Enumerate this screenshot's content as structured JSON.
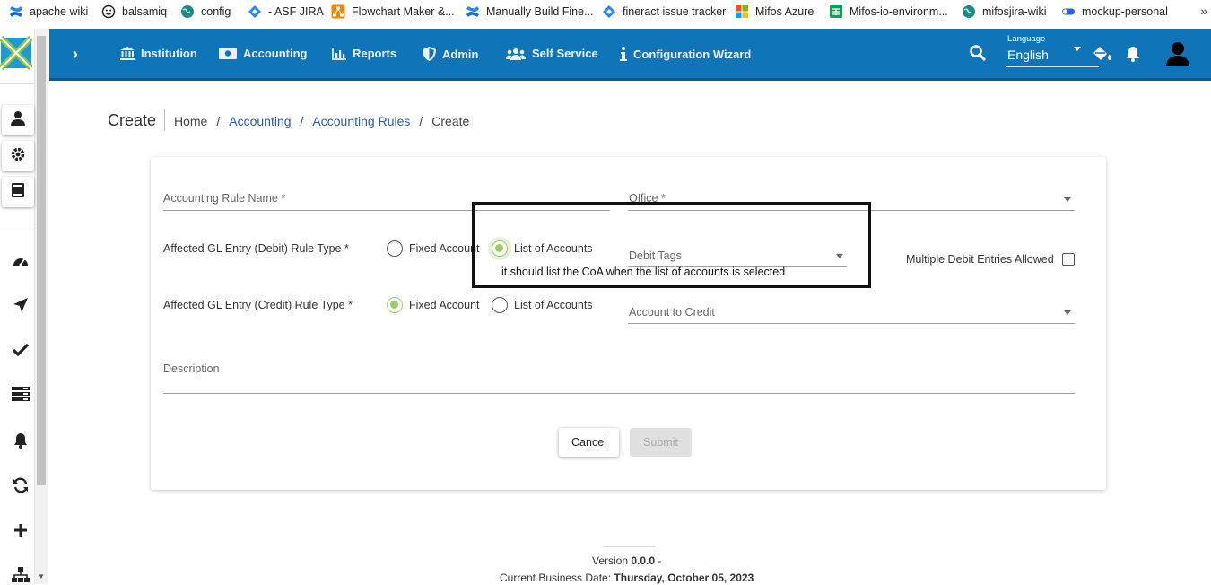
{
  "bookmarks": [
    {
      "label": "apache wiki",
      "icon": "confluence-icon"
    },
    {
      "label": "balsamiq",
      "icon": "smiley-icon"
    },
    {
      "label": "config",
      "icon": "globe-icon"
    },
    {
      "label": "- ASF JIRA",
      "icon": "jira-icon"
    },
    {
      "label": "Flowchart Maker &...",
      "icon": "drawio-icon"
    },
    {
      "label": "Manually Build Fine...",
      "icon": "confluence-icon"
    },
    {
      "label": "fineract issue tracker",
      "icon": "jira-icon"
    },
    {
      "label": "Mifos Azure",
      "icon": "microsoft-icon"
    },
    {
      "label": "Mifos-io-environm...",
      "icon": "sheets-icon"
    },
    {
      "label": "mifosjira-wiki",
      "icon": "globe-icon"
    },
    {
      "label": "mockup-personal",
      "icon": "toggle-icon"
    }
  ],
  "bookmarks_more": "»",
  "nav": {
    "toggle": "›",
    "items": [
      "Institution",
      "Accounting",
      "Reports",
      "Admin",
      "Self Service",
      "Configuration Wizard"
    ],
    "language_label": "Language",
    "language_value": "English"
  },
  "header": {
    "title": "Create",
    "breadcrumbs": [
      "Home",
      "Accounting",
      "Accounting Rules",
      "Create"
    ],
    "separator": "/"
  },
  "form": {
    "rule_name_label": "Accounting Rule Name *",
    "office_label": "Office *",
    "debit_rule_label": "Affected GL Entry (Debit) Rule Type *",
    "credit_rule_label": "Affected GL Entry (Credit) Rule Type *",
    "fixed_account": "Fixed Account",
    "list_of_accounts": "List of Accounts",
    "debit_selected": "List of Accounts",
    "credit_selected": "Fixed Account",
    "debit_tags_label": "Debit Tags",
    "multiple_debit_label": "Multiple Debit Entries Allowed",
    "multiple_debit_checked": false,
    "account_to_credit_label": "Account to Credit",
    "description_label": "Description",
    "cancel": "Cancel",
    "submit": "Submit"
  },
  "annotation": "it should list the CoA when the list of accounts is selected",
  "footer": {
    "version_label": "Version",
    "version_value": "0.0.0",
    "version_suffix": "-",
    "business_date_label": "Current Business Date:",
    "business_date_value": "Thursday, October 05, 2023"
  },
  "colors": {
    "primary": "#1074b9",
    "link": "#2e5ba7",
    "radio_selected": "#9ccc65"
  }
}
